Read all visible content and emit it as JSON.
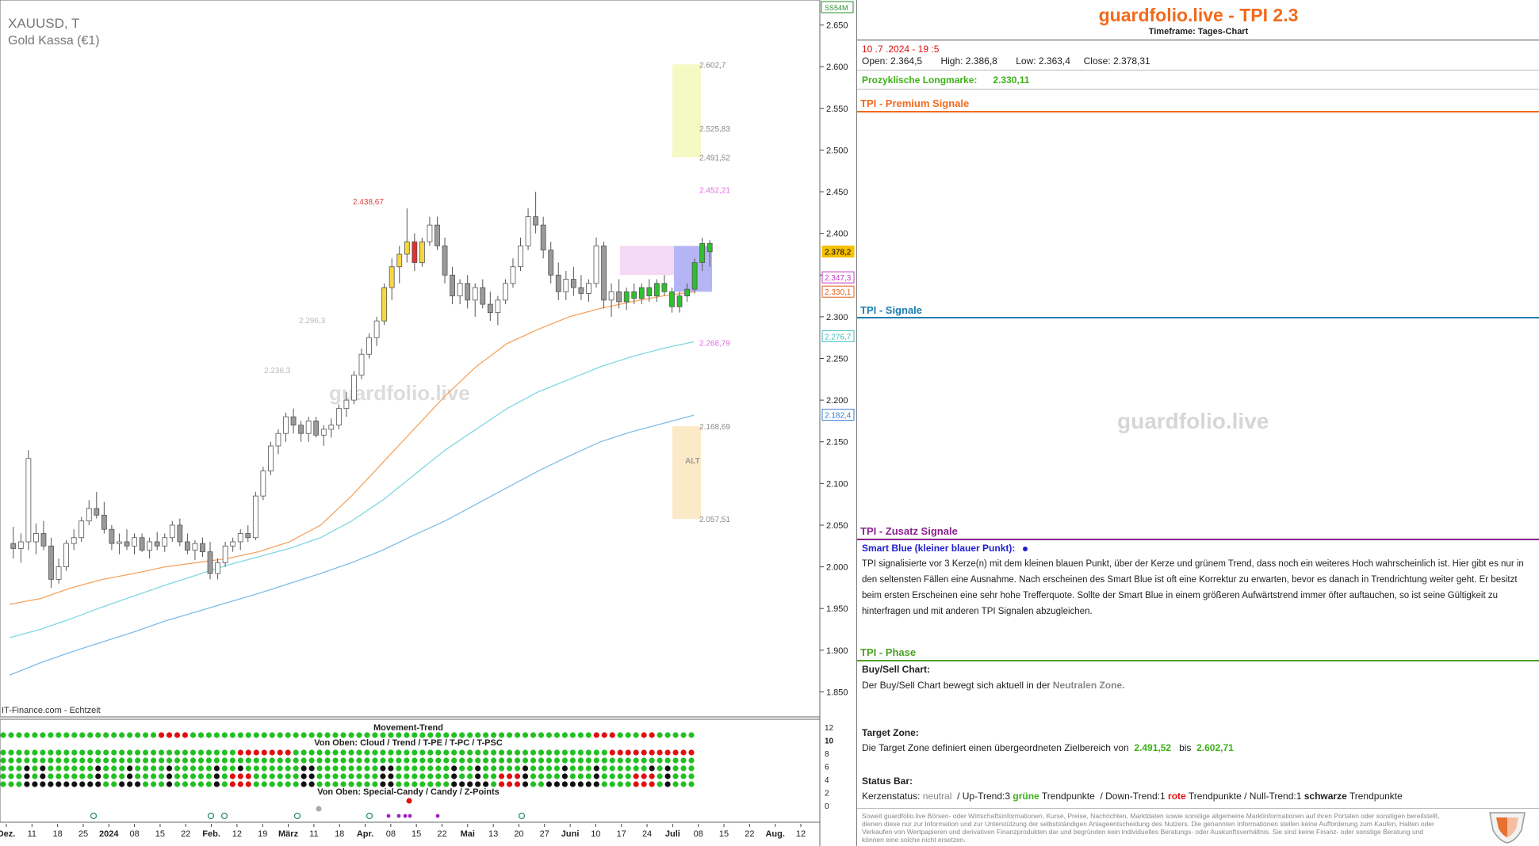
{
  "chart_header": {
    "symbol": "XAUUSD, T",
    "instrument": "Gold Kassa (€1)",
    "feed": "IT-Finance.com - Echtzeit",
    "price_tag_top": "SS54M",
    "watermark": "guardfolio.live"
  },
  "chart_data": [
    {
      "type": "candlestick",
      "ylim": [
        1820,
        2680
      ],
      "y_ticks": [
        "2.650",
        "2.600",
        "2.550",
        "2.500",
        "2.450",
        "2.400",
        "2.350",
        "2.300",
        "2.250",
        "2.200",
        "2.150",
        "2.100",
        "2.050",
        "2.000",
        "1.950",
        "1.900",
        "1.850"
      ],
      "y_tick_values": [
        2650,
        2600,
        2550,
        2500,
        2450,
        2400,
        2350,
        2300,
        2250,
        2200,
        2150,
        2100,
        2050,
        2000,
        1950,
        1900,
        1850
      ],
      "x_ticks": [
        "Dez.",
        "11",
        "18",
        "25",
        "2024",
        "08",
        "15",
        "22",
        "Feb.",
        "12",
        "19",
        "März",
        "11",
        "18",
        "Apr.",
        "08",
        "15",
        "22",
        "Mai",
        "13",
        "20",
        "27",
        "Juni",
        "10",
        "17",
        "24",
        "Juli",
        "08",
        "15",
        "22",
        "Aug.",
        "12"
      ],
      "price_labels": [
        {
          "text": "2.378,2",
          "value": 2378.2,
          "color": "#f5c000"
        },
        {
          "text": "2.347,3",
          "value": 2347.3,
          "color": "#c040c0"
        },
        {
          "text": "2.330,1",
          "value": 2330.1,
          "color": "#e06020"
        },
        {
          "text": "2.276,7",
          "value": 2276.7,
          "color": "#40c0c0"
        },
        {
          "text": "2.182,4",
          "value": 2182.4,
          "color": "#3a7bd5"
        }
      ],
      "annotations": [
        {
          "text": "2.602,7",
          "value": 2602.7,
          "color": "#888"
        },
        {
          "text": "2.525,83",
          "value": 2525.83,
          "color": "#888"
        },
        {
          "text": "2.491,52",
          "value": 2491.52,
          "color": "#888"
        },
        {
          "text": "2.452,21",
          "value": 2452.21,
          "color": "#e070e0"
        },
        {
          "text": "2.268,79",
          "value": 2268.79,
          "color": "#e070e0"
        },
        {
          "text": "2.168,69",
          "value": 2168.69,
          "color": "#888"
        },
        {
          "text": "2.057,51",
          "value": 2057.51,
          "color": "#888"
        },
        {
          "text": "2.438,67",
          "value": 2438.67,
          "color": "#e04040"
        },
        {
          "text": "2.296,3",
          "value": 2296.3,
          "color": "#bbb"
        },
        {
          "text": "2.236,3",
          "value": 2236.3,
          "color": "#bbb"
        },
        {
          "text": "ALT",
          "value": 2128,
          "color": "#999"
        }
      ],
      "candles": [
        {
          "o": 2028,
          "h": 2048,
          "l": 2010,
          "c": 2022
        },
        {
          "o": 2022,
          "h": 2040,
          "l": 2005,
          "c": 2030
        },
        {
          "o": 2030,
          "h": 2140,
          "l": 2020,
          "c": 2130
        },
        {
          "o": 2030,
          "h": 2052,
          "l": 2015,
          "c": 2040
        },
        {
          "o": 2040,
          "h": 2055,
          "l": 2020,
          "c": 2025
        },
        {
          "o": 2025,
          "h": 2035,
          "l": 1975,
          "c": 1985
        },
        {
          "o": 1985,
          "h": 2010,
          "l": 1980,
          "c": 2000
        },
        {
          "o": 2000,
          "h": 2032,
          "l": 1995,
          "c": 2028
        },
        {
          "o": 2028,
          "h": 2045,
          "l": 2020,
          "c": 2035
        },
        {
          "o": 2035,
          "h": 2060,
          "l": 2030,
          "c": 2055
        },
        {
          "o": 2055,
          "h": 2080,
          "l": 2050,
          "c": 2070
        },
        {
          "o": 2070,
          "h": 2090,
          "l": 2058,
          "c": 2062
        },
        {
          "o": 2062,
          "h": 2078,
          "l": 2040,
          "c": 2045
        },
        {
          "o": 2045,
          "h": 2050,
          "l": 2020,
          "c": 2028
        },
        {
          "o": 2028,
          "h": 2040,
          "l": 2015,
          "c": 2030
        },
        {
          "o": 2030,
          "h": 2045,
          "l": 2020,
          "c": 2025
        },
        {
          "o": 2025,
          "h": 2040,
          "l": 2015,
          "c": 2035
        },
        {
          "o": 2035,
          "h": 2040,
          "l": 2018,
          "c": 2020
        },
        {
          "o": 2020,
          "h": 2035,
          "l": 2010,
          "c": 2030
        },
        {
          "o": 2030,
          "h": 2042,
          "l": 2020,
          "c": 2025
        },
        {
          "o": 2025,
          "h": 2040,
          "l": 2018,
          "c": 2035
        },
        {
          "o": 2035,
          "h": 2055,
          "l": 2030,
          "c": 2050
        },
        {
          "o": 2050,
          "h": 2058,
          "l": 2025,
          "c": 2030
        },
        {
          "o": 2030,
          "h": 2040,
          "l": 2015,
          "c": 2020
        },
        {
          "o": 2020,
          "h": 2032,
          "l": 2008,
          "c": 2028
        },
        {
          "o": 2028,
          "h": 2035,
          "l": 2012,
          "c": 2018
        },
        {
          "o": 2018,
          "h": 2030,
          "l": 1985,
          "c": 1992
        },
        {
          "o": 1992,
          "h": 2010,
          "l": 1985,
          "c": 2005
        },
        {
          "o": 2005,
          "h": 2030,
          "l": 2000,
          "c": 2025
        },
        {
          "o": 2025,
          "h": 2035,
          "l": 2018,
          "c": 2030
        },
        {
          "o": 2030,
          "h": 2045,
          "l": 2020,
          "c": 2040
        },
        {
          "o": 2040,
          "h": 2050,
          "l": 2030,
          "c": 2035
        },
        {
          "o": 2035,
          "h": 2090,
          "l": 2032,
          "c": 2085
        },
        {
          "o": 2085,
          "h": 2120,
          "l": 2080,
          "c": 2115
        },
        {
          "o": 2115,
          "h": 2150,
          "l": 2110,
          "c": 2145
        },
        {
          "o": 2145,
          "h": 2165,
          "l": 2135,
          "c": 2160
        },
        {
          "o": 2160,
          "h": 2185,
          "l": 2150,
          "c": 2180
        },
        {
          "o": 2180,
          "h": 2190,
          "l": 2160,
          "c": 2170
        },
        {
          "o": 2170,
          "h": 2175,
          "l": 2150,
          "c": 2160
        },
        {
          "o": 2160,
          "h": 2180,
          "l": 2150,
          "c": 2175
        },
        {
          "o": 2175,
          "h": 2180,
          "l": 2155,
          "c": 2158
        },
        {
          "o": 2158,
          "h": 2170,
          "l": 2145,
          "c": 2165
        },
        {
          "o": 2165,
          "h": 2178,
          "l": 2155,
          "c": 2170
        },
        {
          "o": 2170,
          "h": 2195,
          "l": 2165,
          "c": 2190
        },
        {
          "o": 2190,
          "h": 2210,
          "l": 2180,
          "c": 2200
        },
        {
          "o": 2200,
          "h": 2235,
          "l": 2195,
          "c": 2230
        },
        {
          "o": 2230,
          "h": 2262,
          "l": 2225,
          "c": 2255
        },
        {
          "o": 2255,
          "h": 2280,
          "l": 2250,
          "c": 2275
        },
        {
          "o": 2275,
          "h": 2300,
          "l": 2265,
          "c": 2295
        },
        {
          "o": 2295,
          "h": 2340,
          "l": 2290,
          "c": 2335
        },
        {
          "o": 2335,
          "h": 2370,
          "l": 2320,
          "c": 2360
        },
        {
          "o": 2360,
          "h": 2385,
          "l": 2340,
          "c": 2375
        },
        {
          "o": 2375,
          "h": 2430,
          "l": 2365,
          "c": 2390
        },
        {
          "o": 2390,
          "h": 2400,
          "l": 2355,
          "c": 2365
        },
        {
          "o": 2365,
          "h": 2395,
          "l": 2360,
          "c": 2390
        },
        {
          "o": 2390,
          "h": 2420,
          "l": 2385,
          "c": 2410
        },
        {
          "o": 2410,
          "h": 2420,
          "l": 2380,
          "c": 2385
        },
        {
          "o": 2385,
          "h": 2395,
          "l": 2340,
          "c": 2350
        },
        {
          "o": 2350,
          "h": 2360,
          "l": 2315,
          "c": 2325
        },
        {
          "o": 2325,
          "h": 2345,
          "l": 2315,
          "c": 2340
        },
        {
          "o": 2340,
          "h": 2350,
          "l": 2310,
          "c": 2320
        },
        {
          "o": 2320,
          "h": 2340,
          "l": 2300,
          "c": 2335
        },
        {
          "o": 2335,
          "h": 2345,
          "l": 2310,
          "c": 2315
        },
        {
          "o": 2315,
          "h": 2330,
          "l": 2295,
          "c": 2305
        },
        {
          "o": 2305,
          "h": 2325,
          "l": 2290,
          "c": 2320
        },
        {
          "o": 2320,
          "h": 2345,
          "l": 2315,
          "c": 2340
        },
        {
          "o": 2340,
          "h": 2370,
          "l": 2335,
          "c": 2360
        },
        {
          "o": 2360,
          "h": 2395,
          "l": 2355,
          "c": 2385
        },
        {
          "o": 2385,
          "h": 2430,
          "l": 2380,
          "c": 2420
        },
        {
          "o": 2420,
          "h": 2450,
          "l": 2400,
          "c": 2410
        },
        {
          "o": 2410,
          "h": 2420,
          "l": 2370,
          "c": 2380
        },
        {
          "o": 2380,
          "h": 2390,
          "l": 2340,
          "c": 2350
        },
        {
          "o": 2350,
          "h": 2365,
          "l": 2320,
          "c": 2330
        },
        {
          "o": 2330,
          "h": 2355,
          "l": 2320,
          "c": 2345
        },
        {
          "o": 2345,
          "h": 2360,
          "l": 2325,
          "c": 2335
        },
        {
          "o": 2335,
          "h": 2350,
          "l": 2320,
          "c": 2328
        },
        {
          "o": 2328,
          "h": 2345,
          "l": 2318,
          "c": 2340
        },
        {
          "o": 2340,
          "h": 2395,
          "l": 2335,
          "c": 2385
        },
        {
          "o": 2385,
          "h": 2390,
          "l": 2310,
          "c": 2320
        },
        {
          "o": 2320,
          "h": 2340,
          "l": 2300,
          "c": 2330
        },
        {
          "o": 2330,
          "h": 2345,
          "l": 2310,
          "c": 2318
        },
        {
          "o": 2318,
          "h": 2335,
          "l": 2308,
          "c": 2330
        },
        {
          "o": 2330,
          "h": 2340,
          "l": 2315,
          "c": 2322
        },
        {
          "o": 2322,
          "h": 2340,
          "l": 2315,
          "c": 2335
        },
        {
          "o": 2335,
          "h": 2345,
          "l": 2318,
          "c": 2325
        },
        {
          "o": 2325,
          "h": 2345,
          "l": 2318,
          "c": 2340
        },
        {
          "o": 2340,
          "h": 2350,
          "l": 2325,
          "c": 2330
        },
        {
          "o": 2330,
          "h": 2335,
          "l": 2305,
          "c": 2312
        },
        {
          "o": 2312,
          "h": 2330,
          "l": 2305,
          "c": 2325
        },
        {
          "o": 2325,
          "h": 2340,
          "l": 2318,
          "c": 2333
        },
        {
          "o": 2333,
          "h": 2370,
          "l": 2328,
          "c": 2365
        },
        {
          "o": 2365,
          "h": 2395,
          "l": 2355,
          "c": 2388
        },
        {
          "o": 2388,
          "h": 2392,
          "l": 2360,
          "c": 2378
        }
      ],
      "series": [
        {
          "name": "EMA orange",
          "color": "#f4a460",
          "values": [
            1955,
            1962,
            1975,
            1985,
            1992,
            2000,
            2005,
            2010,
            2018,
            2030,
            2050,
            2085,
            2125,
            2165,
            2205,
            2240,
            2268,
            2285,
            2300,
            2310,
            2318,
            2325,
            2330
          ]
        },
        {
          "name": "EMA cyan",
          "color": "#7fd8e0",
          "values": [
            1915,
            1925,
            1938,
            1952,
            1965,
            1978,
            1990,
            2002,
            2012,
            2022,
            2035,
            2055,
            2080,
            2110,
            2140,
            2165,
            2190,
            2210,
            2225,
            2240,
            2252,
            2262,
            2270
          ]
        },
        {
          "name": "EMA blue",
          "color": "#7fbde8",
          "values": [
            1870,
            1885,
            1898,
            1910,
            1922,
            1935,
            1946,
            1957,
            1968,
            1980,
            1992,
            2005,
            2020,
            2038,
            2055,
            2075,
            2095,
            2115,
            2133,
            2150,
            2162,
            2172,
            2182
          ]
        }
      ]
    },
    {
      "type": "heatmap",
      "title": "Movement-Trend",
      "subtitle_1": "Von Oben: Cloud / Trend / T-PE / T-PC / T-PSC",
      "subtitle_2": "Von Oben: Special-Candy / Candy / Z-Points",
      "y_ticks": [
        "12",
        "10",
        "8",
        "6",
        "4",
        "2",
        "0"
      ],
      "colors": {
        "green": "#22c022",
        "red": "#e01010",
        "black": "#111111"
      }
    }
  ],
  "side_panel": {
    "brand": "guardfolio.live - TPI 2.3",
    "timeframe": "Timeframe: Tages-Chart",
    "date": "10 .7 .2024  - 19 :5",
    "open_label": "Open:",
    "open_value": "2.364,5",
    "high_label": "High:",
    "high_value": "2.386,8",
    "low_label": "Low:",
    "low_value": "2.363,4",
    "close_label": "Close:",
    "close_value": "2.378,31",
    "longmarke_label": "Prozyklische Longmarke:",
    "longmarke_value": "2.330,11",
    "sec_premium": "TPI - Premium Signale",
    "sec_signale": "TPI - Signale",
    "sec_zusatz": "TPI - Zusatz Signale",
    "smart_blue_title": "Smart Blue (kleiner blauer Punkt):",
    "smart_blue_text": "TPI signalisierte vor 3  Kerze(n) mit dem kleinen blauen Punkt, über der Kerze und grünem Trend, dass noch ein weiteres Hoch wahrscheinlich ist. Hier gibt es nur in den seltensten Fällen eine Ausnahme. Nach erscheinen des Smart Blue ist oft eine Korrektur zu erwarten, bevor es danach in Trendrichtung weiter geht. Er besitzt beim ersten Erscheinen eine sehr hohe Trefferquote. Sollte der Smart Blue in einem größeren Aufwärtstrend immer öfter auftauchen, so ist seine Gültigkeit zu hinterfragen und mit anderen TPI Signalen abzugleichen.",
    "sec_phase": "TPI - Phase",
    "buysell_title": "Buy/Sell Chart:",
    "buysell_text": "Der Buy/Sell Chart bewegt sich aktuell in der",
    "buysell_zone": "Neutralen Zone.",
    "target_title": "Target Zone:",
    "target_text": "Die Target Zone definiert einen übergeordneten Zielbereich von",
    "target_low": "2.491,52",
    "target_and": "bis",
    "target_high": "2.602,71",
    "status_title": "Status Bar:",
    "status_prefix": "Kerzenstatus:",
    "status_neutral": "neutral",
    "status_up": "/ Up-Trend:3",
    "status_gruene": "grüne",
    "status_tp1": "Trendpunkte",
    "status_down": "/ Down-Trend:1",
    "status_rote": "rote",
    "status_tp2": "Trendpunkte",
    "status_null": "/ Null-Trend:1",
    "status_schwarze": "schwarze",
    "status_tp3": "Trendpunkte",
    "watermark": "guardfolio.live",
    "disclaimer": "Soweit guardfolio.live Börsen- oder Wirtschaftsinformationen, Kurse, Preise, Nachrichten, Marktdaten sowie sonstige allgemeine Marktinformationen auf ihren Portalen oder sonstigen bereitstellt, dienen diese nur zur Information und zur Unterstützung der selbstständigen Anlageentscheidung des Nutzers. Die genannten Informationen stellen keine Aufforderung zum Kaufen, Halten oder Verkaufen von Wertpapieren und derivativen Finanzprodukten dar und begründen kein individuelles Beratungs- oder Auskunftsverhältnis. Sie sind keine Finanz- oder sonstige Beratung und können eine solche nicht ersetzen."
  }
}
